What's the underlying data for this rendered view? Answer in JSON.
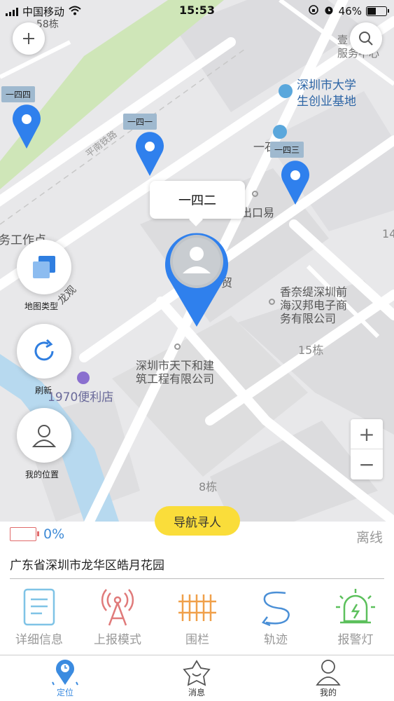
{
  "status_bar": {
    "carrier": "中国移动",
    "time": "15:53",
    "battery": "46%",
    "battery_level": 0.46
  },
  "map": {
    "labels": {
      "top_left_text": "58栋",
      "service_center": "壹\n服务中心",
      "poi_startup_base_1": "深圳市大学",
      "poi_startup_base_2": "生创业基地",
      "partial_text_one": "一石",
      "road_pingnan": "平南铁路",
      "building_14": "14",
      "import_export": "出口易",
      "service_point": "务工作点",
      "road_street": "龙观",
      "company_1": "香奈缇深圳前",
      "company_2": "海汉邦电子商",
      "company_3": "务有限公司",
      "building_15": "15栋",
      "tianxia_1": "深圳市天下和建",
      "tianxia_2": "筑工程有限公司",
      "store_1970": "1970便利店",
      "building_8": "8栋",
      "market_partial": "贸"
    },
    "pins": [
      {
        "label": "一四四"
      },
      {
        "label": "一四一"
      },
      {
        "label": "一四三"
      }
    ],
    "selected_pin": {
      "label": "一四二"
    },
    "side_buttons": {
      "map_type": "地图类型",
      "refresh": "刷新",
      "my_location": "我的位置"
    },
    "zoom": {
      "in": "+",
      "out": "−"
    }
  },
  "device": {
    "navigate_button": "导航寻人",
    "battery_percent": "0%",
    "status": "离线",
    "address": "广东省深圳市龙华区皓月花园"
  },
  "actions": [
    {
      "label": "详细信息",
      "icon": "document-icon",
      "color": "#7fc3e6"
    },
    {
      "label": "上报模式",
      "icon": "antenna-icon",
      "color": "#e07a7a"
    },
    {
      "label": "围栏",
      "icon": "fence-icon",
      "color": "#f0a04a"
    },
    {
      "label": "轨迹",
      "icon": "track-icon",
      "color": "#4a8fd6"
    },
    {
      "label": "报警灯",
      "icon": "alarm-light-icon",
      "color": "#5cc05c"
    }
  ],
  "tabs": [
    {
      "label": "定位",
      "icon": "location-icon",
      "active": true
    },
    {
      "label": "消息",
      "icon": "message-icon",
      "active": false
    },
    {
      "label": "我的",
      "icon": "profile-icon",
      "active": false
    }
  ],
  "colors": {
    "accent": "#3b8be0",
    "pin": "#2f80ed",
    "nav_button": "#fadd3a"
  }
}
